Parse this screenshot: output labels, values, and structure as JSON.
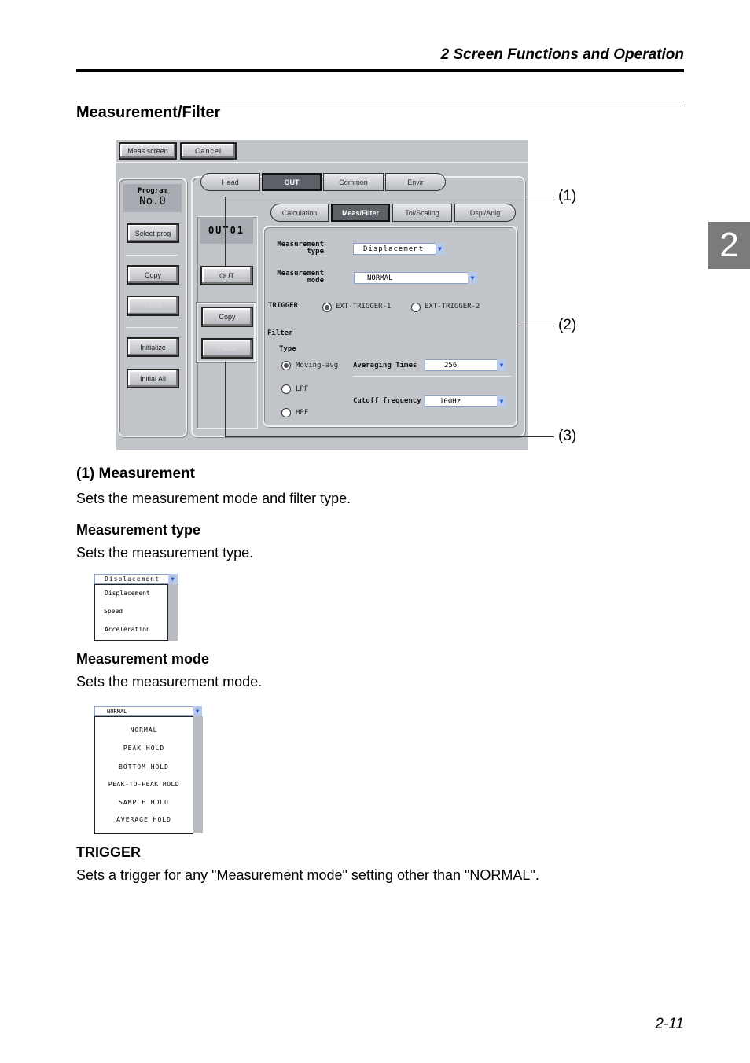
{
  "header": {
    "chapter_title": "2  Screen Functions and Operation",
    "chapter_tab": "2",
    "page_number": "2-11"
  },
  "section_title": "Measurement/Filter",
  "screen": {
    "top_buttons": [
      "Meas screen",
      "Cancel"
    ],
    "program_label": "Program",
    "program_no": "No.0",
    "left_buttons": {
      "select": "Select prog",
      "copy": "Copy",
      "paste": "Paste",
      "initialize": "Initialize",
      "initial_all": "Initial All"
    },
    "main_tabs": [
      {
        "label": "Head"
      },
      {
        "label": "OUT",
        "active": true
      },
      {
        "label": "Common"
      },
      {
        "label": "Envir"
      }
    ],
    "out_name": "OUT01",
    "out_button": "OUT",
    "out_copy": "Copy",
    "out_paste": "Paste",
    "sub_tabs": [
      {
        "label": "Calculation"
      },
      {
        "label": "Meas/Filter",
        "active": true
      },
      {
        "label": "Tol/Scaling"
      },
      {
        "label": "Dspl/Anlg"
      }
    ],
    "meas_type_label": [
      "Measurement",
      "type"
    ],
    "meas_type_value": "Displacement",
    "meas_mode_label": [
      "Measurement",
      "mode"
    ],
    "meas_mode_value": "NORMAL",
    "trigger_label": "TRIGGER",
    "trigger_options": [
      "EXT-TRIGGER-1",
      "EXT-TRIGGER-2"
    ],
    "trigger_selected": "EXT-TRIGGER-1",
    "filter_label": "Filter",
    "type_label": "Type",
    "filter_types": [
      "Moving-avg",
      "LPF",
      "HPF"
    ],
    "filter_selected": "Moving-avg",
    "averaging_label": "Averaging Times",
    "averaging_value": "256",
    "cutoff_label": "Cutoff frequency",
    "cutoff_value": "100Hz"
  },
  "callouts": [
    "(1)",
    "(2)",
    "(3)"
  ],
  "sections": [
    {
      "title": "(1) Measurement",
      "text": "Sets the measurement mode and filter type."
    },
    {
      "title": "Measurement type",
      "text": "Sets the measurement type."
    },
    {
      "title": "Measurement mode",
      "text": "Sets the measurement mode."
    },
    {
      "title": "TRIGGER",
      "text": "Sets a trigger for any \"Measurement mode\" setting other than \"NORMAL\"."
    }
  ],
  "type_dropdown": {
    "value": "Displacement",
    "options": [
      "Displacement",
      "Speed",
      "Acceleration"
    ]
  },
  "mode_dropdown": {
    "value": "NORMAL",
    "options": [
      "NORMAL",
      "PEAK HOLD",
      "BOTTOM HOLD",
      "PEAK-TO-PEAK HOLD",
      "SAMPLE HOLD",
      "AVERAGE HOLD"
    ]
  }
}
